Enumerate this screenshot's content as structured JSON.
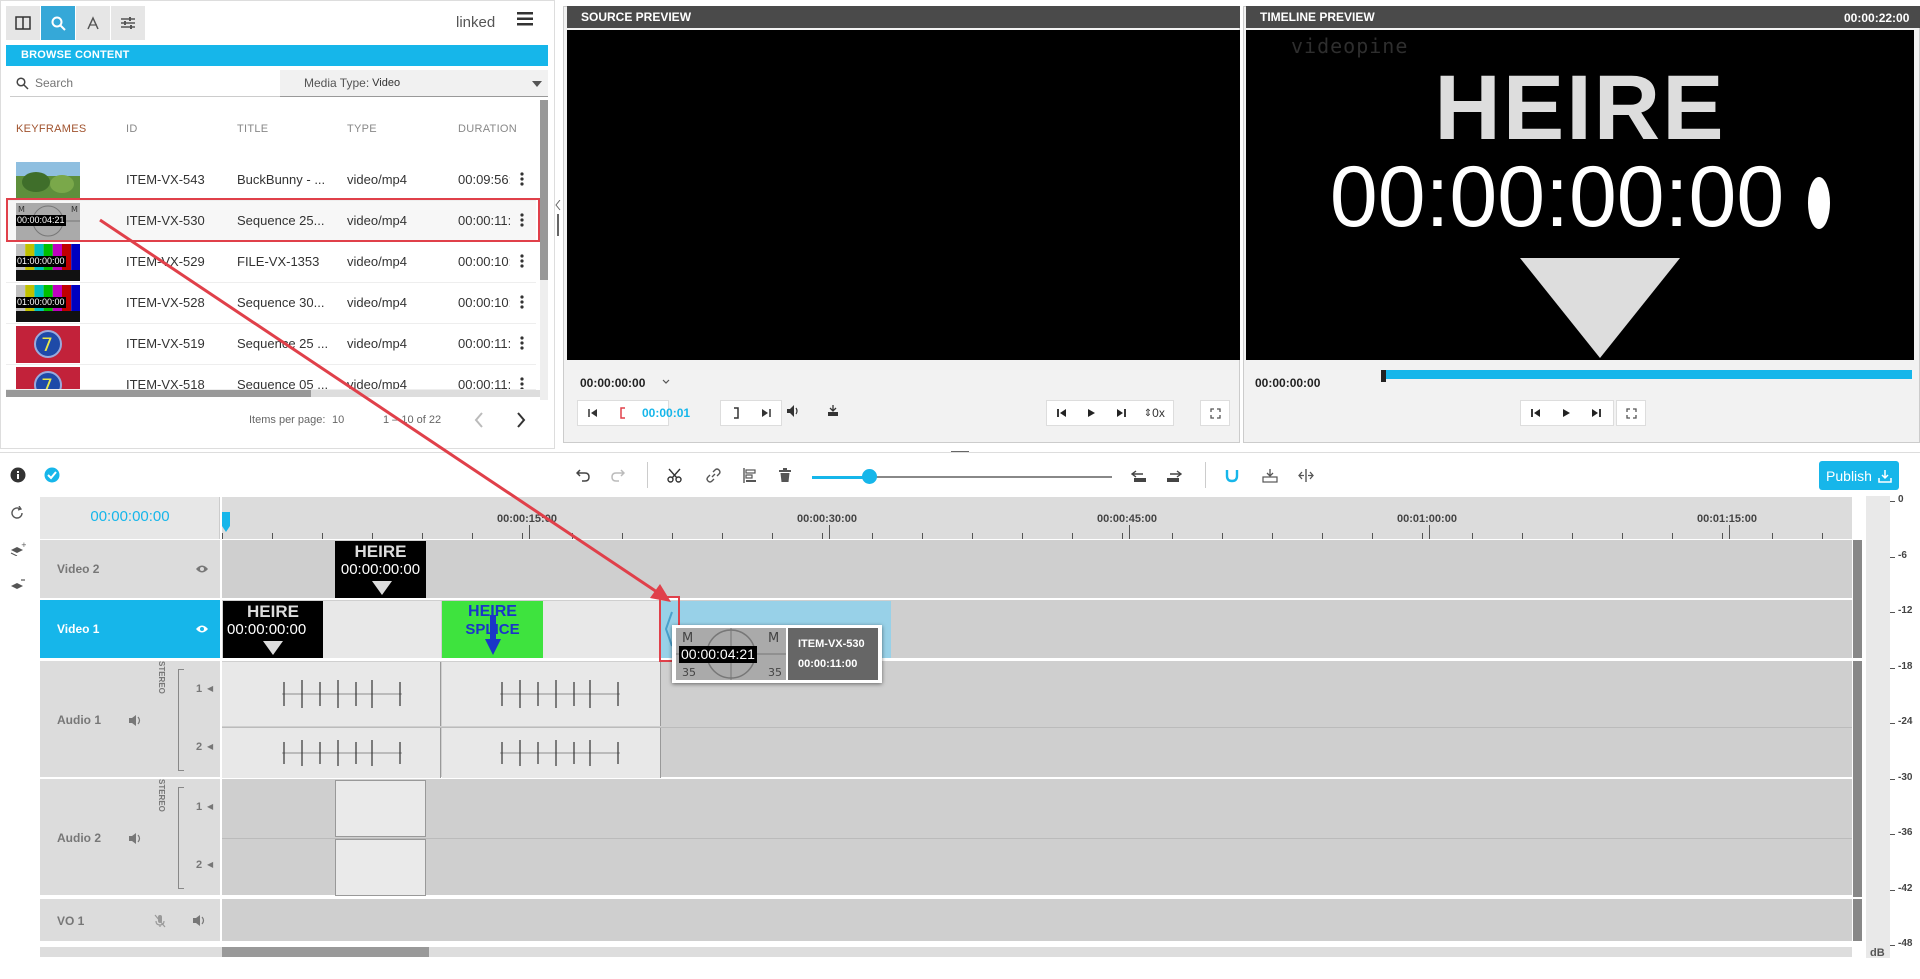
{
  "browser": {
    "linked_label": "linked",
    "browse_title": "BROWSE CONTENT",
    "search_placeholder": "Search",
    "media_type_label": "Media Type:",
    "media_type_value": "Video",
    "columns": [
      "KEYFRAMES",
      "ID",
      "TITLE",
      "TYPE",
      "DURATION"
    ],
    "rows": [
      {
        "id": "ITEM-VX-543",
        "title": "BuckBunny - ...",
        "type": "video/mp4",
        "duration": "00:09:56:",
        "thumb": "bunny",
        "thumb_tc": ""
      },
      {
        "id": "ITEM-VX-530",
        "title": "Sequence 25...",
        "type": "video/mp4",
        "duration": "00:00:11:",
        "thumb": "countdown",
        "thumb_tc": "00:00:04:21"
      },
      {
        "id": "ITEM-VX-529",
        "title": "FILE-VX-1353",
        "type": "video/mp4",
        "duration": "00:00:10:",
        "thumb": "bars",
        "thumb_tc": "01:00:00:00"
      },
      {
        "id": "ITEM-VX-528",
        "title": "Sequence 30...",
        "type": "video/mp4",
        "duration": "00:00:10:",
        "thumb": "bars",
        "thumb_tc": "01:00:00:00"
      },
      {
        "id": "ITEM-VX-519",
        "title": "Sequence 25 ...",
        "type": "video/mp4",
        "duration": "00:00:11:",
        "thumb": "seven",
        "thumb_tc": ""
      },
      {
        "id": "ITEM-VX-518",
        "title": "Sequence 05 ...",
        "type": "video/mp4",
        "duration": "00:00:11:",
        "thumb": "seven",
        "thumb_tc": ""
      }
    ],
    "pager_label": "Items per page:",
    "pager_size": "10",
    "pager_range": "1 – 10 of 22"
  },
  "source_preview": {
    "title": "SOURCE PREVIEW",
    "timecode": "00:00:00:00",
    "in_timecode": "00:00:01",
    "speed": "0x"
  },
  "timeline_preview": {
    "title": "TIMELINE PREVIEW",
    "duration": "00:00:22:00",
    "timecode": "00:00:00:00",
    "screen_tc": "00:00:00:00",
    "screen_word": "HEIRE",
    "screen_logo": "videopine",
    "progress": 1.0
  },
  "editor": {
    "publish_label": "Publish",
    "playhead_tc": "00:00:00:00",
    "zoom_level": 0.19,
    "ruler": [
      "00:00:15:00",
      "00:00:30:00",
      "00:00:45:00",
      "00:01:00:00",
      "00:01:15:00"
    ],
    "tracks": {
      "video2": "Video 2",
      "video1": "Video 1",
      "audio1": "Audio 1",
      "audio2": "Audio 2",
      "vo1": "VO 1",
      "stereo": "STEREO",
      "ch1": "1",
      "ch2": "2"
    },
    "clip_tc": "00:00:00:00",
    "clip_word": "HEIRE",
    "splice_word": "SPLICE",
    "drag_item_id": "ITEM-VX-530",
    "drag_item_duration": "00:00:11:00",
    "drag_thumb_tc": "00:00:04:21",
    "db_scale": [
      "0",
      "-6",
      "-12",
      "-18",
      "-24",
      "-30",
      "-36",
      "-42",
      "-48"
    ],
    "db_unit": "dB"
  },
  "colors": {
    "accent": "#16b6ea",
    "annotation": "#e0404a",
    "header_dark": "#4a4a4a"
  }
}
